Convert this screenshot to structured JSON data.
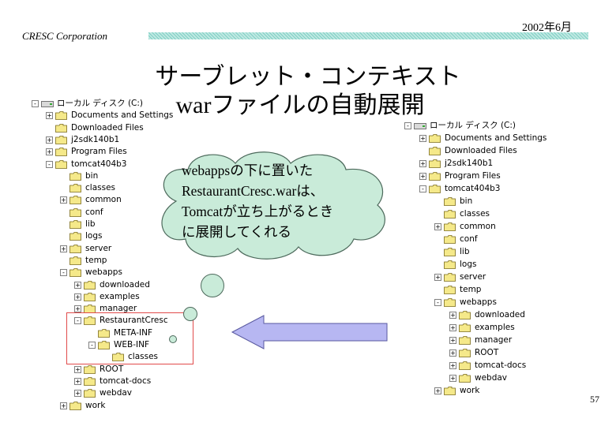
{
  "header": {
    "company": "CRESC Corporation",
    "date": "2002年6月"
  },
  "title": {
    "line1": "サーブレット・コンテキスト",
    "line2": "warファイルの自動展開"
  },
  "callout": {
    "lines": [
      "webappsの下に置いた",
      "RestaurantCresc.warは、",
      "Tomcatが立ち上がるとき",
      "に展開してくれる"
    ]
  },
  "page_number": "57",
  "colors": {
    "folder": "#f5e98a",
    "bubble": "#c9ebd9",
    "arrow": "#b7b7f2",
    "highlight": "#e14b4b",
    "header_bar": "#7fd0c4"
  },
  "left_tree": [
    {
      "label": "ローカル ディスク (C:)",
      "level": 0,
      "icon": "drive-icon",
      "toggle": "-"
    },
    {
      "label": "Documents and Settings",
      "level": 1,
      "icon": "folder-icon",
      "toggle": "+"
    },
    {
      "label": "Downloaded Files",
      "level": 1,
      "icon": "folder-icon",
      "toggle": ""
    },
    {
      "label": "j2sdk140b1",
      "level": 1,
      "icon": "folder-icon",
      "toggle": "+"
    },
    {
      "label": "Program Files",
      "level": 1,
      "icon": "folder-icon",
      "toggle": "+"
    },
    {
      "label": "tomcat404b3",
      "level": 1,
      "icon": "folder-icon",
      "toggle": "-"
    },
    {
      "label": "bin",
      "level": 2,
      "icon": "folder-icon",
      "toggle": ""
    },
    {
      "label": "classes",
      "level": 2,
      "icon": "folder-icon",
      "toggle": ""
    },
    {
      "label": "common",
      "level": 2,
      "icon": "folder-icon",
      "toggle": "+"
    },
    {
      "label": "conf",
      "level": 2,
      "icon": "folder-icon",
      "toggle": ""
    },
    {
      "label": "lib",
      "level": 2,
      "icon": "folder-icon",
      "toggle": ""
    },
    {
      "label": "logs",
      "level": 2,
      "icon": "folder-icon",
      "toggle": ""
    },
    {
      "label": "server",
      "level": 2,
      "icon": "folder-icon",
      "toggle": "+"
    },
    {
      "label": "temp",
      "level": 2,
      "icon": "folder-icon",
      "toggle": ""
    },
    {
      "label": "webapps",
      "level": 2,
      "icon": "folder-icon",
      "toggle": "-"
    },
    {
      "label": "downloaded",
      "level": 3,
      "icon": "folder-icon",
      "toggle": "+"
    },
    {
      "label": "examples",
      "level": 3,
      "icon": "folder-icon",
      "toggle": "+"
    },
    {
      "label": "manager",
      "level": 3,
      "icon": "folder-icon",
      "toggle": "+"
    },
    {
      "label": "RestaurantCresc",
      "level": 3,
      "icon": "folder-icon",
      "toggle": "-"
    },
    {
      "label": "META-INF",
      "level": 4,
      "icon": "folder-icon",
      "toggle": ""
    },
    {
      "label": "WEB-INF",
      "level": 4,
      "icon": "folder-icon",
      "toggle": "-"
    },
    {
      "label": "classes",
      "level": 5,
      "icon": "folder-icon",
      "toggle": ""
    },
    {
      "label": "ROOT",
      "level": 3,
      "icon": "folder-icon",
      "toggle": "+"
    },
    {
      "label": "tomcat-docs",
      "level": 3,
      "icon": "folder-icon",
      "toggle": "+"
    },
    {
      "label": "webdav",
      "level": 3,
      "icon": "folder-icon",
      "toggle": "+"
    },
    {
      "label": "work",
      "level": 2,
      "icon": "folder-icon",
      "toggle": "+"
    }
  ],
  "right_tree": [
    {
      "label": "ローカル ディスク (C:)",
      "level": 0,
      "icon": "drive-icon",
      "toggle": "-"
    },
    {
      "label": "Documents and Settings",
      "level": 1,
      "icon": "folder-icon",
      "toggle": "+"
    },
    {
      "label": "Downloaded Files",
      "level": 1,
      "icon": "folder-icon",
      "toggle": ""
    },
    {
      "label": "j2sdk140b1",
      "level": 1,
      "icon": "folder-icon",
      "toggle": "+"
    },
    {
      "label": "Program Files",
      "level": 1,
      "icon": "folder-icon",
      "toggle": "+"
    },
    {
      "label": "tomcat404b3",
      "level": 1,
      "icon": "folder-icon",
      "toggle": "-"
    },
    {
      "label": "bin",
      "level": 2,
      "icon": "folder-icon",
      "toggle": ""
    },
    {
      "label": "classes",
      "level": 2,
      "icon": "folder-icon",
      "toggle": ""
    },
    {
      "label": "common",
      "level": 2,
      "icon": "folder-icon",
      "toggle": "+"
    },
    {
      "label": "conf",
      "level": 2,
      "icon": "folder-icon",
      "toggle": ""
    },
    {
      "label": "lib",
      "level": 2,
      "icon": "folder-icon",
      "toggle": ""
    },
    {
      "label": "logs",
      "level": 2,
      "icon": "folder-icon",
      "toggle": ""
    },
    {
      "label": "server",
      "level": 2,
      "icon": "folder-icon",
      "toggle": "+"
    },
    {
      "label": "temp",
      "level": 2,
      "icon": "folder-icon",
      "toggle": ""
    },
    {
      "label": "webapps",
      "level": 2,
      "icon": "folder-icon",
      "toggle": "-"
    },
    {
      "label": "downloaded",
      "level": 3,
      "icon": "folder-icon",
      "toggle": "+"
    },
    {
      "label": "examples",
      "level": 3,
      "icon": "folder-icon",
      "toggle": "+"
    },
    {
      "label": "manager",
      "level": 3,
      "icon": "folder-icon",
      "toggle": "+"
    },
    {
      "label": "ROOT",
      "level": 3,
      "icon": "folder-icon",
      "toggle": "+"
    },
    {
      "label": "tomcat-docs",
      "level": 3,
      "icon": "folder-icon",
      "toggle": "+"
    },
    {
      "label": "webdav",
      "level": 3,
      "icon": "folder-icon",
      "toggle": "+"
    },
    {
      "label": "work",
      "level": 2,
      "icon": "folder-icon",
      "toggle": "+"
    }
  ]
}
